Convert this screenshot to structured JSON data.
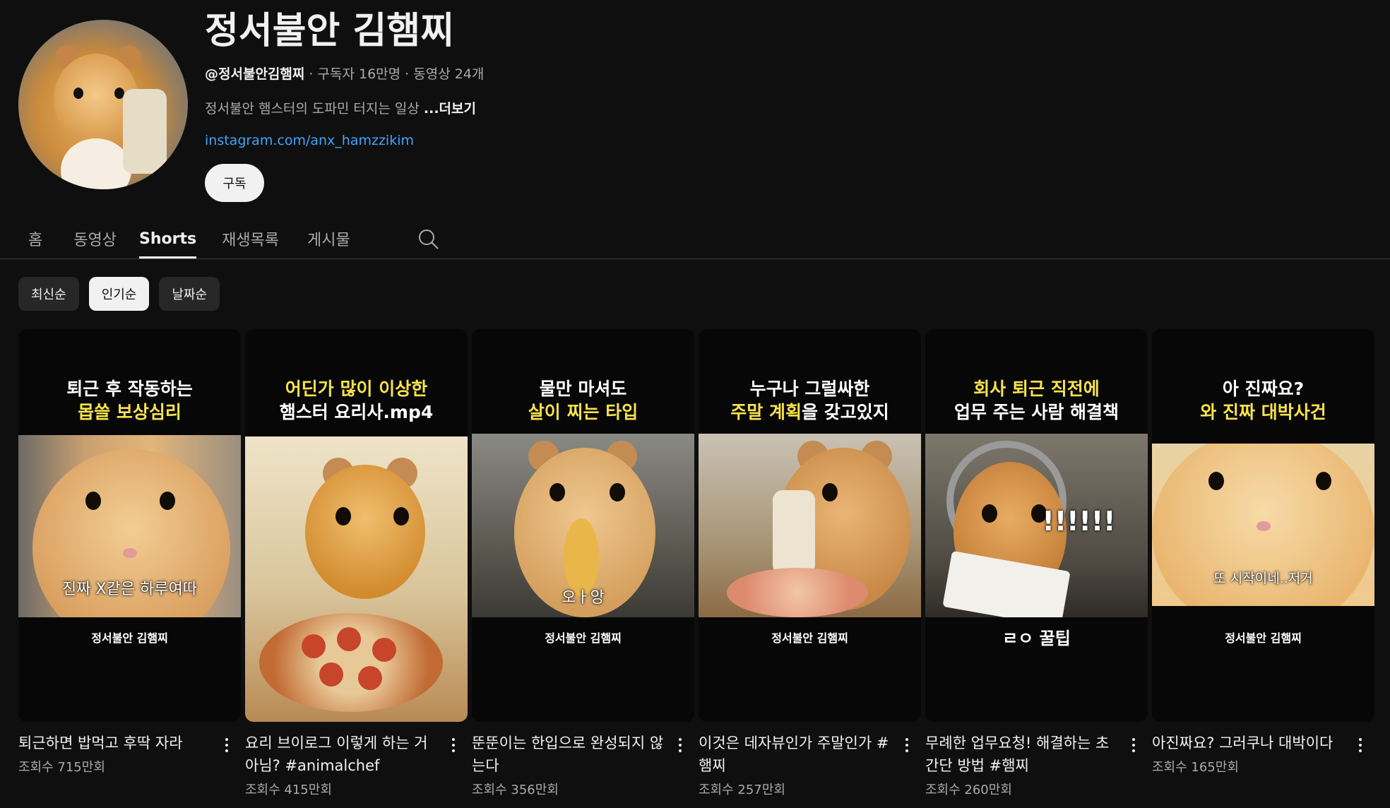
{
  "channel": {
    "title": "정서불안 김햄찌",
    "handle": "@정서불안김햄찌",
    "subscribers": "구독자 16만명",
    "video_count": "동영상 24개",
    "description": "정서불안 햄스터의 도파민 터지는 일상",
    "more_label": "...더보기",
    "link": "instagram.com/anx_hamzzikim",
    "subscribe_label": "구독",
    "separator": " · "
  },
  "tabs": [
    {
      "label": "홈",
      "active": false
    },
    {
      "label": "동영상",
      "active": false
    },
    {
      "label": "Shorts",
      "active": true
    },
    {
      "label": "재생목록",
      "active": false
    },
    {
      "label": "게시물",
      "active": false
    }
  ],
  "chips": [
    {
      "label": "최신순",
      "active": false
    },
    {
      "label": "인기순",
      "active": true
    },
    {
      "label": "날짜순",
      "active": false
    }
  ],
  "shorts": [
    {
      "caption_line1": "퇴근 후 작동하는",
      "caption_line2": "몹쓸 보상심리",
      "overlay_text": "진짜 X같은 하루여따",
      "watermark": "정서불안 김햄찌",
      "title": "퇴근하면 밥먹고 후딱 자라",
      "views": "조회수 715만회"
    },
    {
      "caption_line1": "어딘가 많이 이상한",
      "caption_line2": "햄스터 요리사.mp4",
      "overlay_text": "",
      "watermark": "",
      "title": "요리 브이로그 이렇게 하는 거 아님? #animalchef",
      "views": "조회수 415만회"
    },
    {
      "caption_line1": "물만 마셔도",
      "caption_line2": "살이 찌는 타입",
      "overlay_text": "오ㅏ앙",
      "watermark": "정서불안 김햄찌",
      "title": "뚠뚠이는 한입으로 완성되지 않는다",
      "views": "조회수 356만회"
    },
    {
      "caption_line1": "누구나 그럴싸한",
      "caption_line2_highlight": "주말 계획",
      "caption_line2_rest": "을 갖고있지",
      "overlay_text": "",
      "watermark": "정서불안 김햄찌",
      "title": "이것은 데자뷰인가 주말인가 #햄찌",
      "views": "조회수 257만회"
    },
    {
      "caption_line1": "회사 퇴근 직전에",
      "caption_line2": "업무 주는 사람 해결책",
      "overlay_text": "!!!!!!",
      "watermark": "ㄹㅇ 꿀팁",
      "title": "무례한 업무요청! 해결하는 초간단 방법 #햄찌",
      "views": "조회수 260만회"
    },
    {
      "caption_line1": "아 진짜요?",
      "caption_line2": "와 진짜 대박사건",
      "overlay_text": "또 시작이네..저거",
      "watermark": "정서불안 김햄찌",
      "title": "아진짜요? 그러쿠나 대박이다",
      "views": "조회수 165만회"
    }
  ],
  "icons": {
    "search": "search-icon",
    "more": "more-vert-icon"
  },
  "colors": {
    "background": "#0f0f0f",
    "caption_highlight": "#f7e34a",
    "link": "#3ea6ff"
  }
}
